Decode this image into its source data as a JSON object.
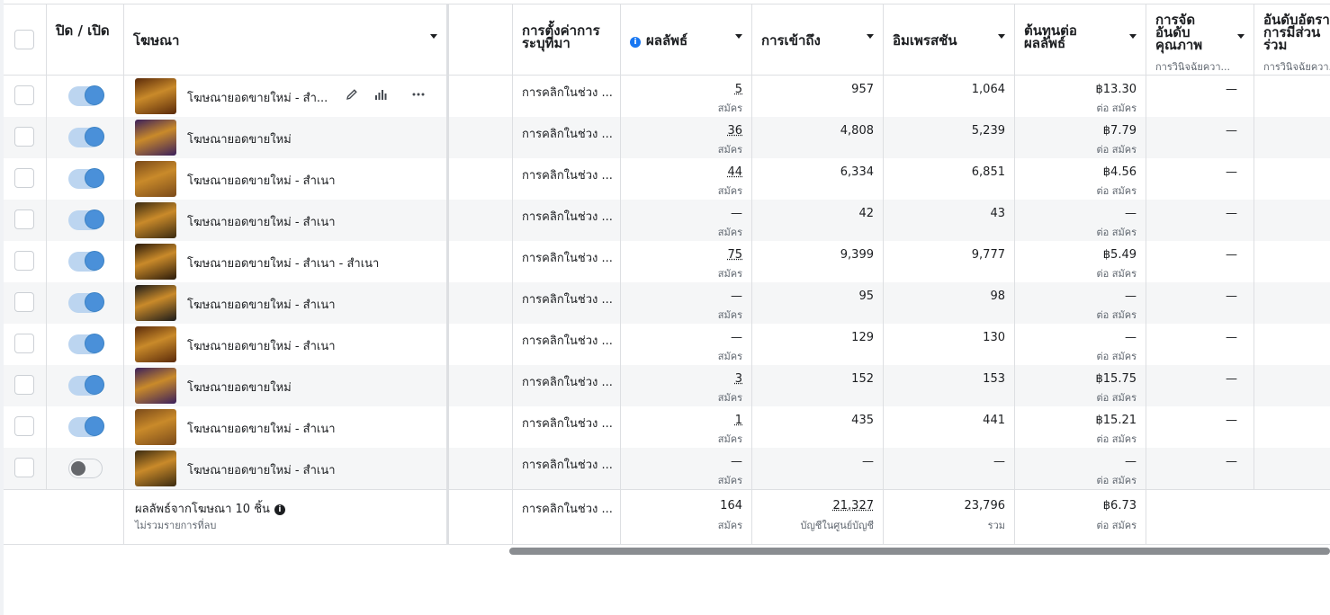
{
  "header": {
    "toggle_label": "ปิด / เปิด",
    "ad_label": "โฆษณา",
    "setting_label": "การตั้งค่าการระบุที่มา",
    "results_label": "ผลลัพธ์",
    "reach_label": "การเข้าถึง",
    "impressions_label": "อิมเพรสชัน",
    "cpr_label": "ต้นทุนต่อผลลัพธ์",
    "quality_label": "การจัดอันดับคุณภาพ",
    "quality_sub": "การวินิจฉัยควา...",
    "engagement_label": "อันดับอัตราการมีส่วนร่วม",
    "engagement_sub": "การวินิจฉัยควา..."
  },
  "rows": [
    {
      "name": "โฆษณายอดขายใหม่ - สำ...",
      "enabled": true,
      "setting": "การคลิกในช่วง ...",
      "results": "5",
      "results_unit": "สมัคร",
      "reach": "957",
      "impressions": "1,064",
      "cpr": "฿13.30",
      "cpr_unit": "ต่อ สมัคร",
      "quality": "—"
    },
    {
      "name": "โฆษณายอดขายใหม่",
      "enabled": true,
      "setting": "การคลิกในช่วง ...",
      "results": "36",
      "results_unit": "สมัคร",
      "reach": "4,808",
      "impressions": "5,239",
      "cpr": "฿7.79",
      "cpr_unit": "ต่อ สมัคร",
      "quality": "—"
    },
    {
      "name": "โฆษณายอดขายใหม่ - สำเนา",
      "enabled": true,
      "setting": "การคลิกในช่วง ...",
      "results": "44",
      "results_unit": "สมัคร",
      "reach": "6,334",
      "impressions": "6,851",
      "cpr": "฿4.56",
      "cpr_unit": "ต่อ สมัคร",
      "quality": "—"
    },
    {
      "name": "โฆษณายอดขายใหม่ - สำเนา",
      "enabled": true,
      "setting": "การคลิกในช่วง ...",
      "results": "—",
      "results_unit": "สมัคร",
      "reach": "42",
      "impressions": "43",
      "cpr": "—",
      "cpr_unit": "ต่อ สมัคร",
      "quality": "—"
    },
    {
      "name": "โฆษณายอดขายใหม่ - สำเนา - สำเนา",
      "enabled": true,
      "setting": "การคลิกในช่วง ...",
      "results": "75",
      "results_unit": "สมัคร",
      "reach": "9,399",
      "impressions": "9,777",
      "cpr": "฿5.49",
      "cpr_unit": "ต่อ สมัคร",
      "quality": "—"
    },
    {
      "name": "โฆษณายอดขายใหม่ - สำเนา",
      "enabled": true,
      "setting": "การคลิกในช่วง ...",
      "results": "—",
      "results_unit": "สมัคร",
      "reach": "95",
      "impressions": "98",
      "cpr": "—",
      "cpr_unit": "ต่อ สมัคร",
      "quality": "—"
    },
    {
      "name": "โฆษณายอดขายใหม่ - สำเนา",
      "enabled": true,
      "setting": "การคลิกในช่วง ...",
      "results": "—",
      "results_unit": "สมัคร",
      "reach": "129",
      "impressions": "130",
      "cpr": "—",
      "cpr_unit": "ต่อ สมัคร",
      "quality": "—"
    },
    {
      "name": "โฆษณายอดขายใหม่",
      "enabled": true,
      "setting": "การคลิกในช่วง ...",
      "results": "3",
      "results_unit": "สมัคร",
      "reach": "152",
      "impressions": "153",
      "cpr": "฿15.75",
      "cpr_unit": "ต่อ สมัคร",
      "quality": "—"
    },
    {
      "name": "โฆษณายอดขายใหม่ - สำเนา",
      "enabled": true,
      "setting": "การคลิกในช่วง ...",
      "results": "1",
      "results_unit": "สมัคร",
      "reach": "435",
      "impressions": "441",
      "cpr": "฿15.21",
      "cpr_unit": "ต่อ สมัคร",
      "quality": "—"
    },
    {
      "name": "โฆษณายอดขายใหม่ - สำเนา",
      "enabled": false,
      "setting": "การคลิกในช่วง ...",
      "results": "—",
      "results_unit": "สมัคร",
      "reach": "—",
      "impressions": "—",
      "cpr": "—",
      "cpr_unit": "ต่อ สมัคร",
      "quality": "—"
    }
  ],
  "footer": {
    "summary": "ผลลัพธ์จากโฆษณา 10 ชิ้น",
    "summary_sub": "ไม่รวมรายการที่ลบ",
    "setting": "การคลิกในช่วง ...",
    "results": "164",
    "results_unit": "สมัคร",
    "reach": "21,327",
    "reach_unit": "บัญชีในศูนย์บัญชี",
    "impressions": "23,796",
    "impressions_unit": "รวม",
    "cpr": "฿6.73",
    "cpr_unit": "ต่อ สมัคร"
  },
  "colors": {
    "toggle_on": "#4a90d9",
    "toggle_track": "#bcd5f0",
    "info": "#1877f2",
    "thumb_palette": [
      "#5a2a0a",
      "#3a1f5c",
      "#7a4a1a",
      "#3a2a10",
      "#2a1a0a",
      "#1a1a1a"
    ]
  },
  "icons": {
    "edit": "pencil-icon",
    "insights": "bar-chart-icon",
    "more": "more-dots-icon"
  }
}
